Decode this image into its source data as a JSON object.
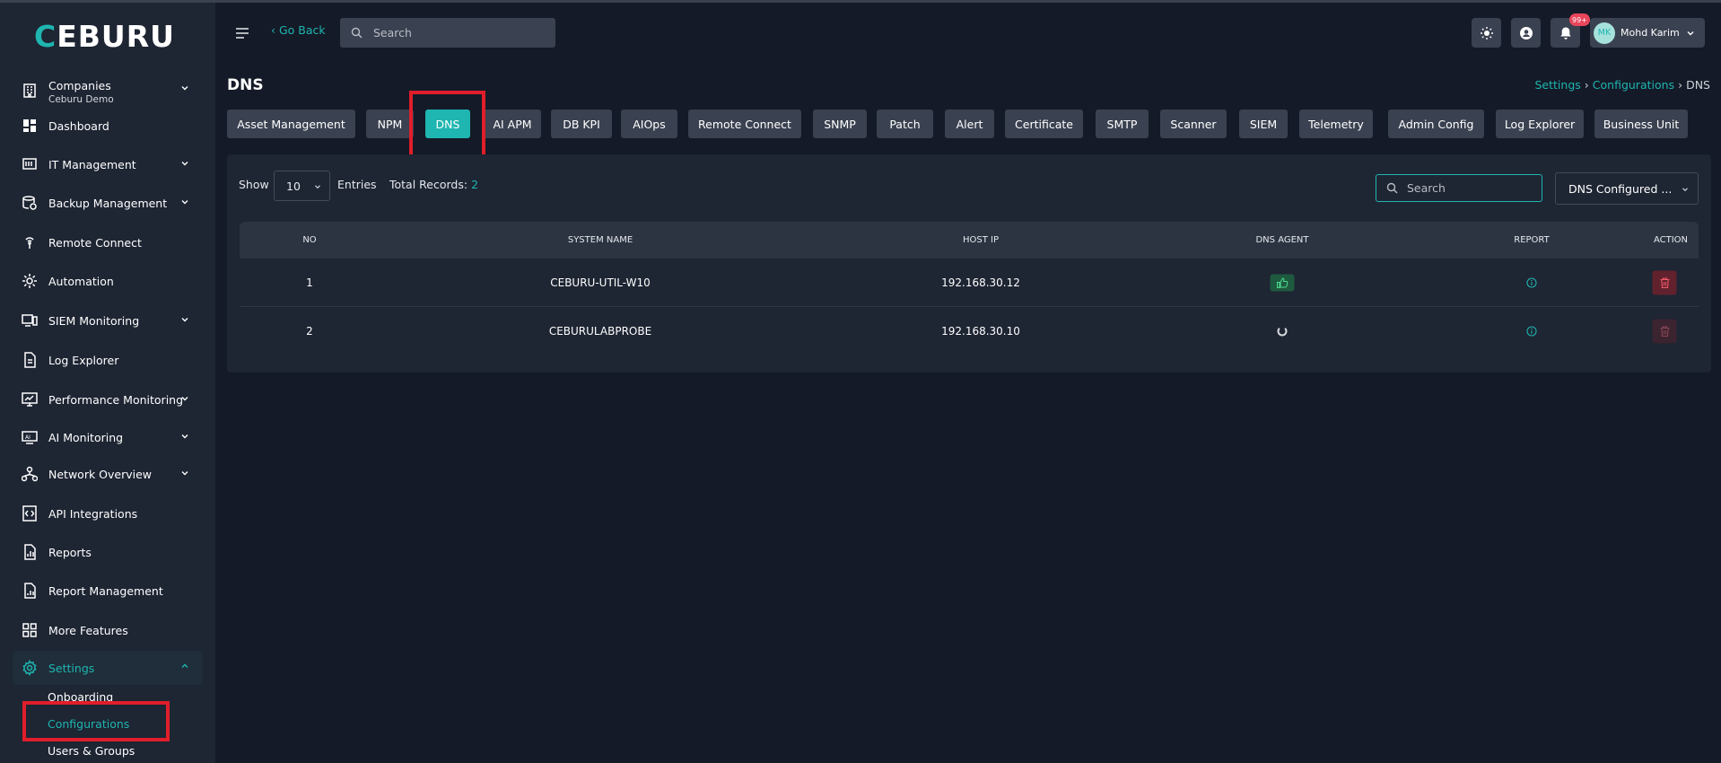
{
  "brand": {
    "logo_accent": "C",
    "logo_rest": "EBURU"
  },
  "sidebar": {
    "company": {
      "title": "Companies",
      "subtitle": "Ceburu Demo"
    },
    "items": [
      {
        "label": "Dashboard",
        "icon": "dashboard-icon"
      },
      {
        "label": "IT Management",
        "icon": "server-icon"
      },
      {
        "label": "Backup Management",
        "icon": "backup-icon"
      },
      {
        "label": "Remote Connect",
        "icon": "remote-icon"
      },
      {
        "label": "Automation",
        "icon": "automation-icon"
      },
      {
        "label": "SIEM Monitoring",
        "icon": "siem-icon"
      },
      {
        "label": "Log Explorer",
        "icon": "document-icon"
      },
      {
        "label": "Performance Monitoring",
        "icon": "monitor-icon"
      },
      {
        "label": "AI Monitoring",
        "icon": "ai-icon"
      },
      {
        "label": "Network Overview",
        "icon": "network-icon"
      },
      {
        "label": "API Integrations",
        "icon": "api-icon"
      },
      {
        "label": "Reports",
        "icon": "report-icon"
      },
      {
        "label": "Report Management",
        "icon": "report-manage-icon"
      },
      {
        "label": "More Features",
        "icon": "grid-icon"
      },
      {
        "label": "Settings",
        "icon": "gear-icon"
      }
    ],
    "settings_sub": [
      "Onboarding",
      "Configurations",
      "Users & Groups"
    ]
  },
  "topbar": {
    "go_back": "‹ Go Back",
    "search_placeholder": "Search",
    "notif_count": "99+",
    "user_initials": "MK",
    "user_name": "Mohd Karim"
  },
  "page": {
    "title": "DNS",
    "breadcrumb": [
      "Settings",
      "›",
      "Configurations",
      "›",
      "DNS"
    ]
  },
  "tabs": [
    "Asset Management",
    "NPM",
    "DNS",
    "AI APM",
    "DB KPI",
    "AIOps",
    "Remote Connect",
    "SNMP",
    "Patch",
    "Alert",
    "Certificate",
    "SMTP",
    "Scanner",
    "SIEM",
    "Telemetry",
    "Admin Config",
    "Log Explorer",
    "Business Unit"
  ],
  "active_tab": "DNS",
  "table": {
    "show_label": "Show",
    "entries_value": "10",
    "entries_label": "Entries",
    "total_label": "Total Records:",
    "total_value": "2",
    "search_placeholder": "Search",
    "filter_value": "DNS Configured ...",
    "columns": [
      "NO",
      "SYSTEM NAME",
      "HOST IP",
      "DNS AGENT",
      "REPORT",
      "ACTION"
    ],
    "rows": [
      {
        "no": "1",
        "system_name": "CEBURU-UTIL-W10",
        "host_ip": "192.168.30.12",
        "dns_agent": "thumbs-up-icon",
        "report": "info-icon",
        "action": "trash-icon"
      },
      {
        "no": "2",
        "system_name": "CEBURULABPROBE",
        "host_ip": "192.168.30.10",
        "dns_agent": "spinner-icon",
        "report": "info-icon",
        "action": "trash-icon"
      }
    ]
  },
  "colors": {
    "accent": "#1fb5b0",
    "highlight": "#e01e2b",
    "danger": "#e8455a"
  }
}
